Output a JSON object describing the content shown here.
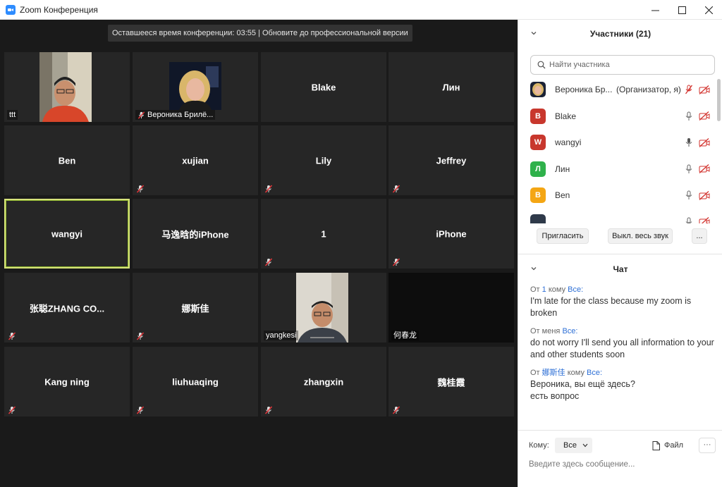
{
  "window": {
    "title": "Zoom Конференция"
  },
  "meeting": {
    "banner": "Оставшееся время конференции: 03:55 | Обновите до профессиональной версии"
  },
  "tiles": [
    {
      "name": "ttt",
      "mode": "corner",
      "muted": false,
      "video": "person1"
    },
    {
      "name": "Вероника Брилё...",
      "mode": "corner",
      "muted": true,
      "video": "person2"
    },
    {
      "name": "Blake",
      "mode": "center",
      "muted": false
    },
    {
      "name": "Лин",
      "mode": "center",
      "muted": false
    },
    {
      "name": "Ben",
      "mode": "center",
      "muted": false
    },
    {
      "name": "xujian",
      "mode": "center",
      "muted": true
    },
    {
      "name": "Lily",
      "mode": "center",
      "muted": true
    },
    {
      "name": "Jeffrey",
      "mode": "center",
      "muted": true
    },
    {
      "name": "wangyi",
      "mode": "center",
      "muted": false,
      "active": true
    },
    {
      "name": "马逸晗的iPhone",
      "mode": "center",
      "muted": false
    },
    {
      "name": "1",
      "mode": "center",
      "muted": true
    },
    {
      "name": "iPhone",
      "mode": "center",
      "muted": true
    },
    {
      "name": "张聪ZHANG  CO...",
      "mode": "center",
      "muted": true
    },
    {
      "name": "娜斯佳",
      "mode": "center",
      "muted": true
    },
    {
      "name": "yangkesi",
      "mode": "corner",
      "muted": false,
      "video": "person3"
    },
    {
      "name": "何春龙",
      "mode": "corner",
      "muted": false,
      "video": "dark"
    },
    {
      "name": "Kang ning",
      "mode": "center",
      "muted": true
    },
    {
      "name": "liuhuaqing",
      "mode": "center",
      "muted": true
    },
    {
      "name": "zhangxin",
      "mode": "center",
      "muted": true
    },
    {
      "name": "魏桂霞",
      "mode": "center",
      "muted": true
    }
  ],
  "participants_panel": {
    "title": "Участники (21)",
    "search_placeholder": "Найти участника",
    "items": [
      {
        "name": "Вероника Бр...",
        "role": "(Организатор, я)",
        "avatar_type": "photo",
        "mic": "muted",
        "video": "off"
      },
      {
        "name": "Blake",
        "avatar_letter": "B",
        "avatar_color": "#c8372d",
        "mic": "on",
        "video": "off"
      },
      {
        "name": "wangyi",
        "avatar_letter": "W",
        "avatar_color": "#c8372d",
        "mic": "active",
        "video": "off"
      },
      {
        "name": "Лин",
        "avatar_letter": "Л",
        "avatar_color": "#2fb14b",
        "mic": "on",
        "video": "off"
      },
      {
        "name": "Ben",
        "avatar_letter": "B",
        "avatar_color": "#f4a614",
        "mic": "on",
        "video": "off"
      },
      {
        "name": "",
        "avatar_letter": "",
        "avatar_color": "#2f3a4a",
        "mic": "on",
        "video": "off"
      }
    ],
    "invite_label": "Пригласить",
    "mute_all_label": "Выкл. весь звук",
    "more_label": "..."
  },
  "chat_panel": {
    "title": "Чат",
    "messages": [
      {
        "from_prefix": "От ",
        "from": "1",
        "to_prefix": " кому ",
        "to": "Все:",
        "text": "I'm late for the class because my zoom is broken"
      },
      {
        "from_prefix": "От ",
        "from": "меня",
        "to_prefix": " ",
        "to": "Все:",
        "text": "do not worry I'll send you all information to your and other students soon"
      },
      {
        "from_prefix": "От ",
        "from": "娜斯佳",
        "to_prefix": " кому ",
        "to": "Все:",
        "text1": "Вероника, вы ещё здесь?",
        "text2": "есть вопрос"
      }
    ],
    "to_label": "Кому:",
    "to_value": "Все",
    "file_label": "Файл",
    "more_label": "···",
    "input_placeholder": "Введите здесь сообщение..."
  },
  "colors": {
    "accent_blue": "#2d8cff",
    "muted_red": "#d2322d",
    "active_border": "#d6e27b",
    "tile_bg": "#262626"
  }
}
